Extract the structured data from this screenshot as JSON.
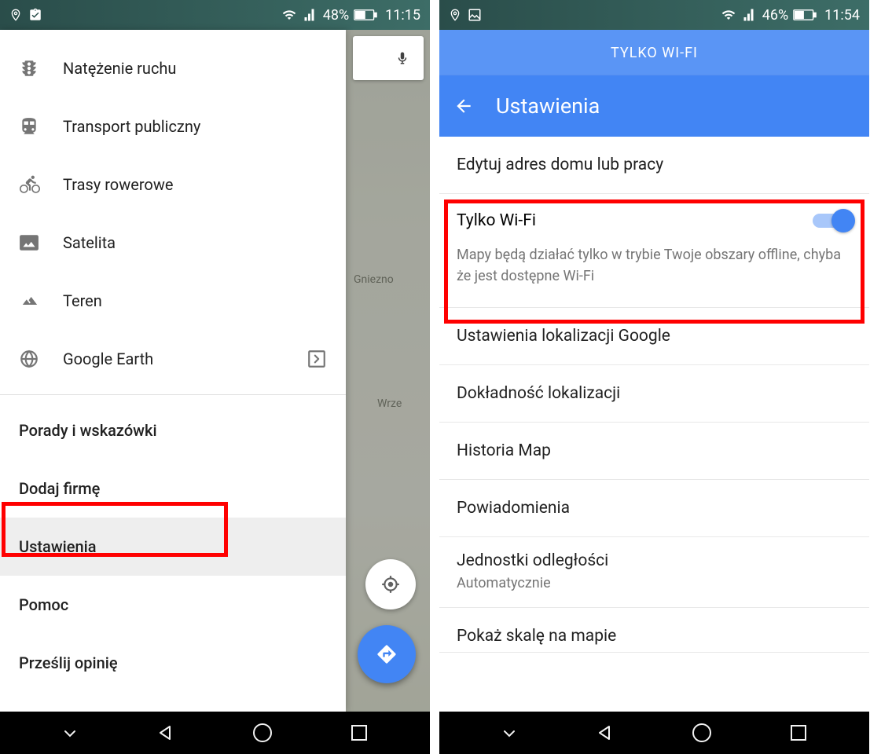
{
  "left": {
    "status": {
      "battery": "48%",
      "time": "11:15"
    },
    "drawer": {
      "items": [
        {
          "label": "Natężenie ruchu",
          "icon": "traffic"
        },
        {
          "label": "Transport publiczny",
          "icon": "train"
        },
        {
          "label": "Trasy rowerowe",
          "icon": "bike"
        },
        {
          "label": "Satelita",
          "icon": "image"
        },
        {
          "label": "Teren",
          "icon": "terrain"
        },
        {
          "label": "Google Earth",
          "icon": "earth",
          "trail": "export"
        }
      ],
      "footer": [
        {
          "label": "Porady i wskazówki"
        },
        {
          "label": "Dodaj firmę"
        },
        {
          "label": "Ustawienia",
          "highlight": true
        },
        {
          "label": "Pomoc"
        },
        {
          "label": "Prześlij opinię"
        }
      ]
    },
    "map_labels": {
      "gniezno": "Gniezno",
      "wrze": "Wrze"
    }
  },
  "right": {
    "status": {
      "battery": "46%",
      "time": "11:54"
    },
    "banner": "TYLKO WI-FI",
    "appbar_title": "Ustawienia",
    "rows": {
      "edit_address": "Edytuj adres domu lub pracy",
      "wifi_title": "Tylko Wi-Fi",
      "wifi_desc_pre": "Mapy będą działać tylko w trybie ",
      "wifi_desc_link": "Twoje obszary offline",
      "wifi_desc_post": ", chyba że jest dostępne Wi-Fi",
      "wifi_on": true,
      "loc_settings": "Ustawienia lokalizacji Google",
      "loc_accuracy": "Dokładność lokalizacji",
      "history": "Historia Map",
      "notifications": "Powiadomienia",
      "distance_units": "Jednostki odległości",
      "distance_value": "Automatycznie",
      "cutoff": "Pokaż skalę na mapie"
    }
  }
}
